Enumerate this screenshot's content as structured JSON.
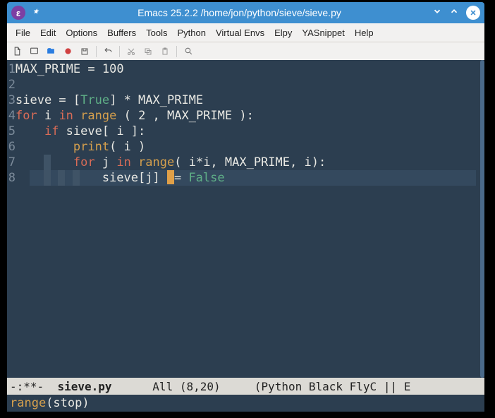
{
  "titlebar": {
    "app_icon_glyph": "ε",
    "title": "Emacs 25.2.2 /home/jon/python/sieve/sieve.py"
  },
  "menubar": {
    "items": [
      "File",
      "Edit",
      "Options",
      "Buffers",
      "Tools",
      "Python",
      "Virtual Envs",
      "Elpy",
      "YASnippet",
      "Help"
    ]
  },
  "editor": {
    "cursor_line": 8,
    "lines": [
      {
        "num": "1",
        "tokens": [
          {
            "t": "MAX_PRIME",
            "c": "tok-id"
          },
          {
            "t": " ",
            "c": "tok-op"
          },
          {
            "t": "=",
            "c": "tok-op"
          },
          {
            "t": " ",
            "c": "tok-op"
          },
          {
            "t": "100",
            "c": "tok-num"
          }
        ]
      },
      {
        "num": "2",
        "tokens": []
      },
      {
        "num": "3",
        "tokens": [
          {
            "t": "sieve",
            "c": "tok-id"
          },
          {
            "t": " = [",
            "c": "tok-op"
          },
          {
            "t": "True",
            "c": "tok-const"
          },
          {
            "t": "] * MAX_PRIME",
            "c": "tok-op"
          }
        ]
      },
      {
        "num": "4",
        "tokens": [
          {
            "t": "for",
            "c": "tok-kw"
          },
          {
            "t": " i ",
            "c": "tok-id"
          },
          {
            "t": "in",
            "c": "tok-kw"
          },
          {
            "t": " ",
            "c": "tok-op"
          },
          {
            "t": "range",
            "c": "tok-builtin"
          },
          {
            "t": " ( 2 , MAX_PRIME ):",
            "c": "tok-op"
          }
        ]
      },
      {
        "num": "5",
        "tokens": [
          {
            "t": "    ",
            "c": "tok-op"
          },
          {
            "t": "if",
            "c": "tok-kw"
          },
          {
            "t": " sieve[ i ]:",
            "c": "tok-id"
          }
        ]
      },
      {
        "num": "6",
        "tokens": [
          {
            "t": "        ",
            "c": "tok-op"
          },
          {
            "t": "print",
            "c": "tok-builtin"
          },
          {
            "t": "( i )",
            "c": "tok-op"
          }
        ]
      },
      {
        "num": "7",
        "tokens": [
          {
            "t": "        ",
            "c": "tok-op"
          },
          {
            "t": "for",
            "c": "tok-kw"
          },
          {
            "t": " j ",
            "c": "tok-id"
          },
          {
            "t": "in",
            "c": "tok-kw"
          },
          {
            "t": " ",
            "c": "tok-op"
          },
          {
            "t": "range",
            "c": "tok-builtin"
          },
          {
            "t": "( i*i, MAX_PRIME, i):",
            "c": "tok-op"
          }
        ]
      },
      {
        "num": "8",
        "tokens": [
          {
            "t": "            sieve[j] ",
            "c": "tok-id"
          },
          {
            "cursor": true
          },
          {
            "t": "= ",
            "c": "tok-op"
          },
          {
            "t": "False",
            "c": "tok-const"
          }
        ]
      }
    ]
  },
  "modeline": {
    "left": "-:**-  ",
    "filename": "sieve.py",
    "mid": "      All (8,20)     (Python Black FlyC || E"
  },
  "minibuffer": {
    "fn": "range",
    "args": "(stop)"
  },
  "colors": {
    "accent": "#3e8fd0",
    "editor_bg": "#2c3e50",
    "keyword": "#d96c57",
    "builtin": "#d6a04d",
    "constant": "#5faf87"
  }
}
